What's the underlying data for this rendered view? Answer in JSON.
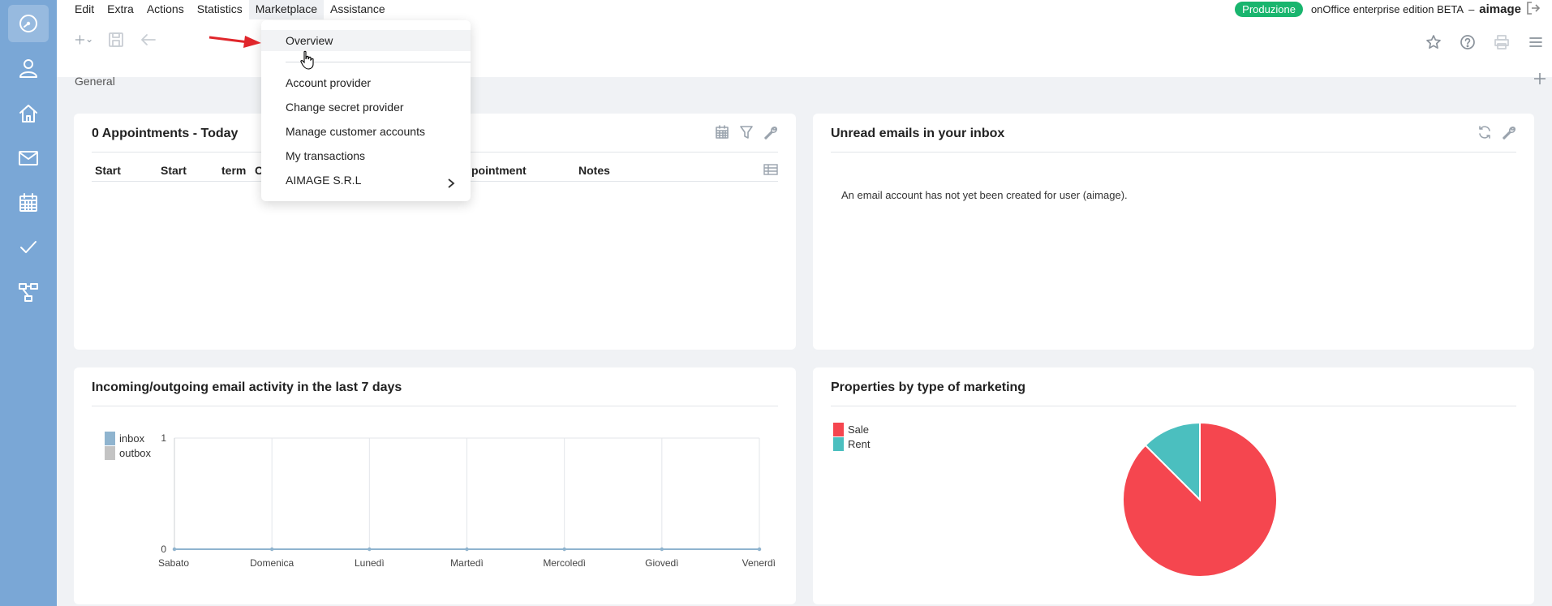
{
  "menu": {
    "items": [
      "Edit",
      "Extra",
      "Actions",
      "Statistics",
      "Marketplace",
      "Assistance"
    ],
    "open_index": 4
  },
  "header": {
    "env_badge": "Produzione",
    "edition": "onOffice enterprise edition BETA",
    "separator": "–",
    "username": "aimage"
  },
  "tabs": {
    "active": "General"
  },
  "dropdown": {
    "first": "Overview",
    "items": [
      "Account provider",
      "Change secret provider",
      "Manage customer accounts",
      "My transactions",
      "AIMAGE S.R.L"
    ]
  },
  "widgets": {
    "appointments": {
      "title": "0 Appointments - Today",
      "columns": [
        "Start",
        "Start",
        "term",
        "C",
        "pointment",
        "Notes"
      ]
    },
    "emails": {
      "title": "Unread emails in your inbox",
      "message": "An email account has not yet been created for user (aimage)."
    },
    "activity": {
      "title": "Incoming/outgoing email activity in the last 7 days"
    },
    "properties": {
      "title": "Properties by type of marketing"
    }
  },
  "colors": {
    "sidebar": "#7aa7d6",
    "badge": "#19b56e",
    "inbox": "#8fb4cf",
    "outbox": "#c3c3c3",
    "sale": "#f5464f",
    "rent": "#4bbfbf",
    "arrow": "#e0262b"
  },
  "chart_data": [
    {
      "type": "line",
      "categories": [
        "Sabato",
        "Domenica",
        "Lunedì",
        "Martedì",
        "Mercoledì",
        "Giovedì",
        "Venerdì"
      ],
      "series": [
        {
          "name": "inbox",
          "values": [
            0,
            0,
            0,
            0,
            0,
            0,
            0
          ]
        },
        {
          "name": "outbox",
          "values": [
            0,
            0,
            0,
            0,
            0,
            0,
            0
          ]
        }
      ],
      "yticks": [
        "0",
        "1"
      ],
      "ylim": [
        0,
        1
      ],
      "legend": "top-left",
      "grid": true
    },
    {
      "type": "pie",
      "labels": [
        "Sale",
        "Rent"
      ],
      "values": [
        87.5,
        12.5
      ],
      "legend": "top-left"
    }
  ]
}
